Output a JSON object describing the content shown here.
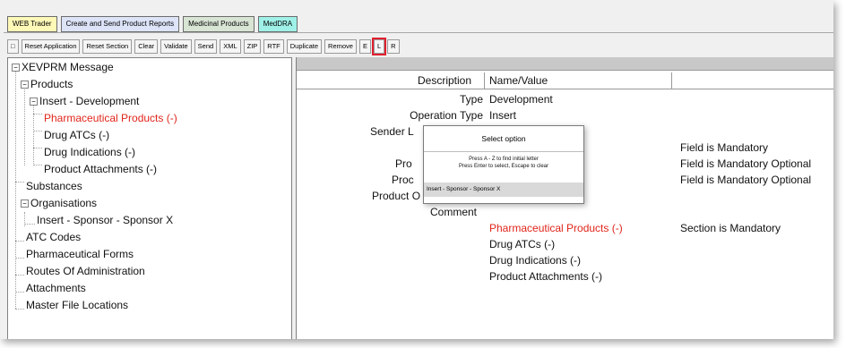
{
  "tabs": [
    {
      "label": "WEB Trader"
    },
    {
      "label": "Create and Send Product Reports"
    },
    {
      "label": "Medicinal Products"
    },
    {
      "label": "MedDRA"
    }
  ],
  "toolbar": {
    "collapse": "□",
    "reset_application": "Reset Application",
    "reset_section": "Reset Section",
    "clear": "Clear",
    "validate": "Validate",
    "send": "Send",
    "xml": "XML",
    "zip": "ZIP",
    "rtf": "RTF",
    "duplicate": "Duplicate",
    "remove": "Remove",
    "e": "E",
    "l": "L",
    "r": "R"
  },
  "tree": {
    "root": "XEVPRM Message",
    "products": "Products",
    "insert_development": "Insert - Development",
    "pharmaceutical_products": "Pharmaceutical Products (-)",
    "drug_atcs": "Drug ATCs (-)",
    "drug_indications": "Drug Indications (-)",
    "product_attachments": "Product Attachments (-)",
    "substances": "Substances",
    "organisations": "Organisations",
    "insert_sponsor": "Insert - Sponsor - Sponsor X",
    "atc_codes": "ATC Codes",
    "pharmaceutical_forms": "Pharmaceutical Forms",
    "routes_of_administration": "Routes Of Administration",
    "attachments": "Attachments",
    "master_file_locations": "Master File Locations"
  },
  "detail": {
    "header_description": "Description",
    "header_name_value": "Name/Value",
    "type_label": "Type",
    "type_value": "Development",
    "operation_type_label": "Operation Type",
    "operation_type_value": "Insert",
    "sender_label_partial": "Sender L",
    "pro1_partial": "Pro",
    "pro2_partial": "Proc",
    "product_o_partial": "Product O",
    "comment_label": "Comment",
    "field_mandatory": "Field is Mandatory",
    "field_optional_1": "Field is Mandatory Optional",
    "field_optional_2": "Field is Mandatory Optional",
    "sub_pharmaceutical_products": "Pharmaceutical Products (-)",
    "section_mandatory": "Section is Mandatory",
    "sub_drug_atcs": "Drug ATCs (-)",
    "sub_drug_indications": "Drug Indications (-)",
    "sub_product_attachments": "Product Attachments (-)"
  },
  "popup": {
    "title": "Select option",
    "help_line1": "Press A - Z to find initial letter",
    "help_line2": "Press Enter to select, Escape to clear",
    "option": "Insert - Sponsor - Sponsor X"
  },
  "colors": {
    "highlight_red": "#e1251b",
    "selected_button_outline": "#e0202e"
  }
}
